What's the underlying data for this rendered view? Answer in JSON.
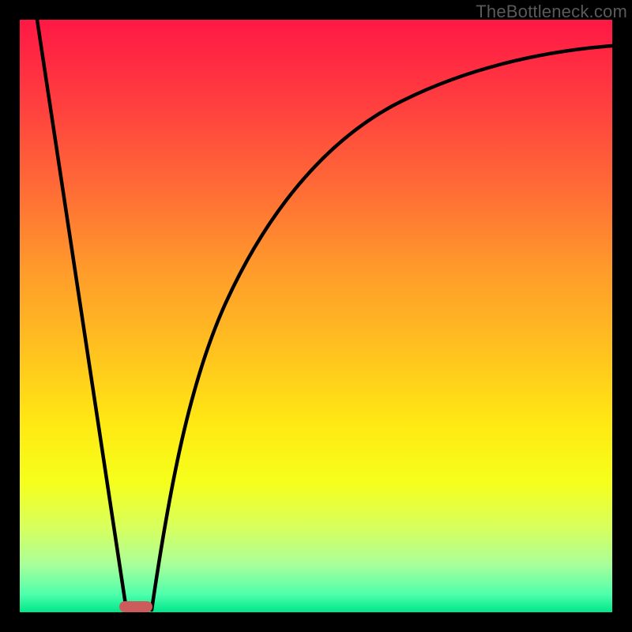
{
  "watermark": "TheBottleneck.com",
  "chart_data": {
    "type": "line",
    "title": "",
    "xlabel": "",
    "ylabel": "",
    "xlim": [
      0,
      100
    ],
    "ylim": [
      0,
      100
    ],
    "grid": false,
    "legend": false,
    "series": [
      {
        "name": "left-branch",
        "x": [
          3,
          18
        ],
        "y": [
          100,
          0
        ]
      },
      {
        "name": "right-branch",
        "x": [
          22,
          26,
          30,
          34,
          38,
          44,
          52,
          62,
          74,
          88,
          100
        ],
        "y": [
          0,
          24,
          42,
          55,
          65,
          74,
          82,
          88,
          92,
          94.5,
          95.5
        ]
      }
    ],
    "marker": {
      "x": 19,
      "y": 0,
      "label": ""
    },
    "gradient_stops": [
      {
        "pct": 0,
        "color": "#ff1845"
      },
      {
        "pct": 100,
        "color": "#00e68a"
      }
    ]
  }
}
